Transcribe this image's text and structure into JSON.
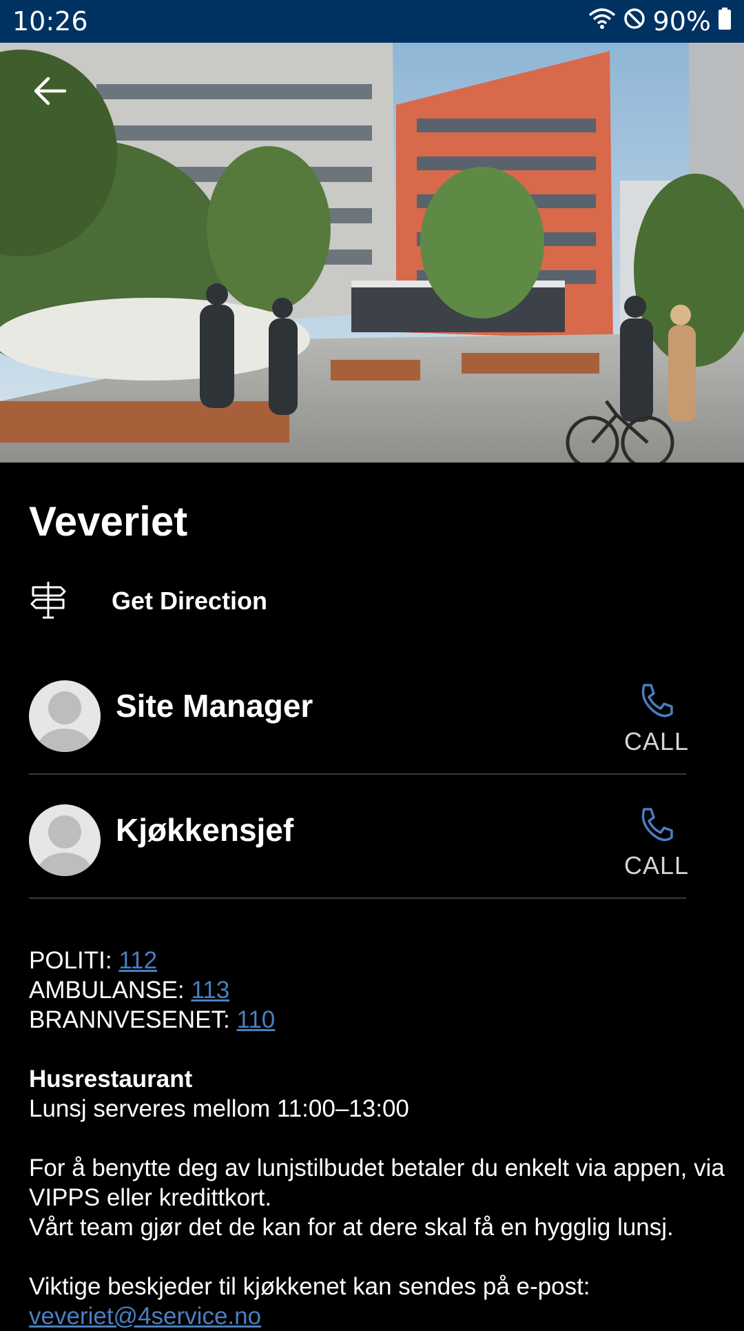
{
  "status_bar": {
    "time": "10:26",
    "battery": "90%",
    "icons": [
      "wifi-icon",
      "do-not-disturb-icon",
      "battery-icon"
    ]
  },
  "hero": {
    "image": "building-courtyard-photo",
    "back_icon": "arrow-left-icon"
  },
  "site": {
    "title": "Veveriet",
    "direction_label": "Get Direction",
    "direction_icon": "signpost-icon"
  },
  "contacts": [
    {
      "name": "Site Manager",
      "call_label": "CALL"
    },
    {
      "name": "Kjøkkensjef",
      "call_label": "CALL"
    }
  ],
  "emergency": [
    {
      "label": "POLITI: ",
      "number": "112"
    },
    {
      "label": "AMBULANSE: ",
      "number": "113"
    },
    {
      "label": "BRANNVESENET: ",
      "number": "110"
    }
  ],
  "restaurant": {
    "heading": "Husrestaurant",
    "hours": "Lunsj serveres mellom 11:00–13:00",
    "text1": "For å benytte deg av lunjstilbudet betaler du enkelt via appen, via VIPPS eller kredittkort.",
    "text2": "Vårt team gjør det de kan for at dere skal få en hygglig lunsj.",
    "text3": "Viktige beskjeder til kjøkkenet kan sendes på e-post:",
    "email": "veveriet@4service.no"
  },
  "colors": {
    "status_bar": "#003262",
    "accent_blue": "#4a7fc0",
    "background": "#000000"
  }
}
